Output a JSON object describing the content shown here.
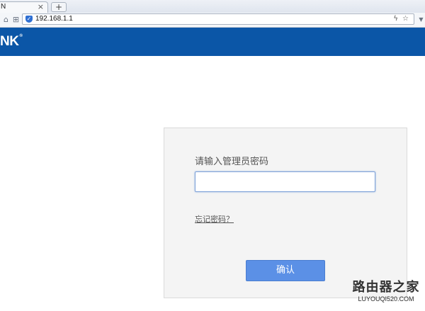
{
  "browser": {
    "tab_title": "N",
    "tab_close": "×",
    "new_tab": "+",
    "url": "192.168.1.1",
    "icons": [
      "home-icon",
      "apps-icon",
      "shield-icon",
      "lightning-icon",
      "star-icon",
      "dropdown-icon"
    ]
  },
  "brand": {
    "logo_text": "NK",
    "logo_mark": "®",
    "bar_color": "#0b56a7"
  },
  "login": {
    "prompt": "请输入管理员密码",
    "password_value": "",
    "forgot_link": "忘记密码？",
    "confirm_label": "确认",
    "button_color": "#5b90e6"
  },
  "watermark": {
    "title": "路由器之家",
    "url": "LUYOUQI520.COM"
  }
}
